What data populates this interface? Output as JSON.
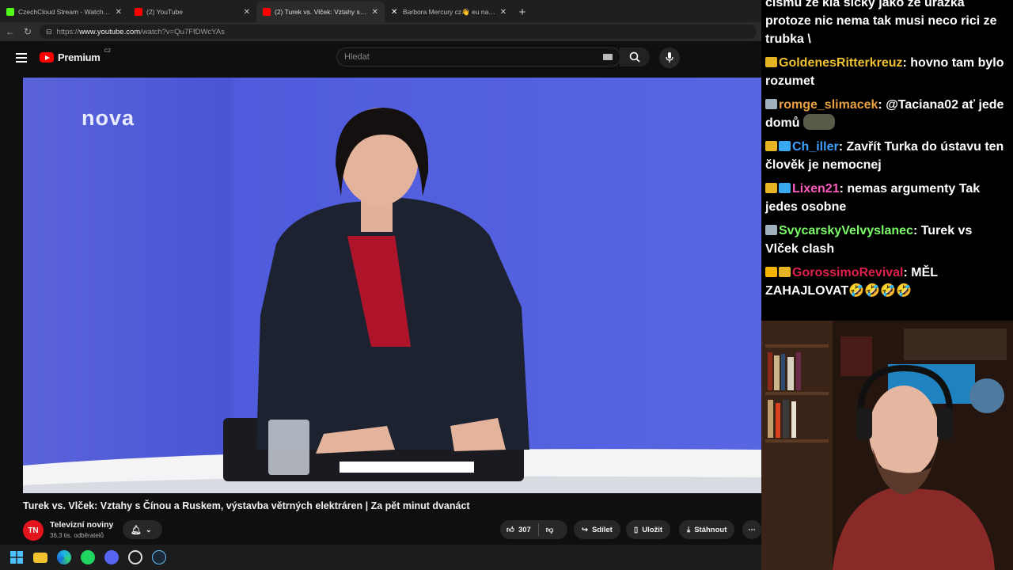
{
  "browser": {
    "tabs": [
      {
        "label": "CzechCloud Stream - Watch Live o",
        "favicon": "kick-icon",
        "color": "#53fc18"
      },
      {
        "label": "(2) YouTube",
        "favicon": "youtube-icon",
        "color": "#ff0000"
      },
      {
        "label": "(2) Turek vs. Vlček: Vztahy s Čínou",
        "favicon": "youtube-icon",
        "color": "#ff0000",
        "active": true
      },
      {
        "label": "Barbora Mercury cz👋 eu na platfo",
        "favicon": "x-icon",
        "color": "#ffffff"
      }
    ],
    "url_prefix": "https://",
    "url_host": "www.youtube.com",
    "url_path": "/watch?v=Qu7FfDWcYAs"
  },
  "youtube": {
    "logo_text": "Premium",
    "logo_region": "CZ",
    "search_placeholder": "Hledat",
    "video_overlay_logo": "nova",
    "video_title": "Turek vs. Vlček: Vztahy s Čínou a Ruskem, výstavba větrných elektráren | Za pět minut dvanáct",
    "channel": {
      "avatar_text": "TN",
      "name": "Televizní noviny",
      "subscribers": "36,3 tis. odběratelů"
    },
    "actions": {
      "likes": "307",
      "share": "Sdílet",
      "save": "Uložit",
      "download": "Stáhnout"
    }
  },
  "chat": {
    "first_message_tail": "cismu ze kla sicky jako ze urazka protoze nic nema tak musi neco rici ze trubka \\",
    "messages": [
      {
        "user": "GoldenesRitterkreuz",
        "color": "#f0c230",
        "text": "hovno tam bylo rozumet",
        "badges": [
          "gold"
        ]
      },
      {
        "user": "romge_slimacek",
        "color": "#e8a040",
        "text": "@Taciana02 ať jede domů",
        "badges": [
          "silver"
        ]
      },
      {
        "user": "Ch_iller",
        "color": "#3ea0ff",
        "text": "Zavřít Turka do ústavu ten člověk je nemocnej",
        "badges": [
          "gold",
          "cube"
        ]
      },
      {
        "user": "Lixen21",
        "color": "#ff5cbf",
        "text": "nemas argumenty Tak jedes osobne",
        "badges": [
          "gold",
          "cube"
        ]
      },
      {
        "user": "SvycarskyVelvyslanec",
        "color": "#7dfc6a",
        "text": "Turek vs Vlček clash",
        "badges": [
          "silver"
        ]
      },
      {
        "user": "GorossimoRevival",
        "color": "#e0204a",
        "text": "MĚL ZAHAJLOVAT🤣🤣🤣🤣",
        "badges": [
          "crown",
          "gold"
        ]
      }
    ]
  }
}
